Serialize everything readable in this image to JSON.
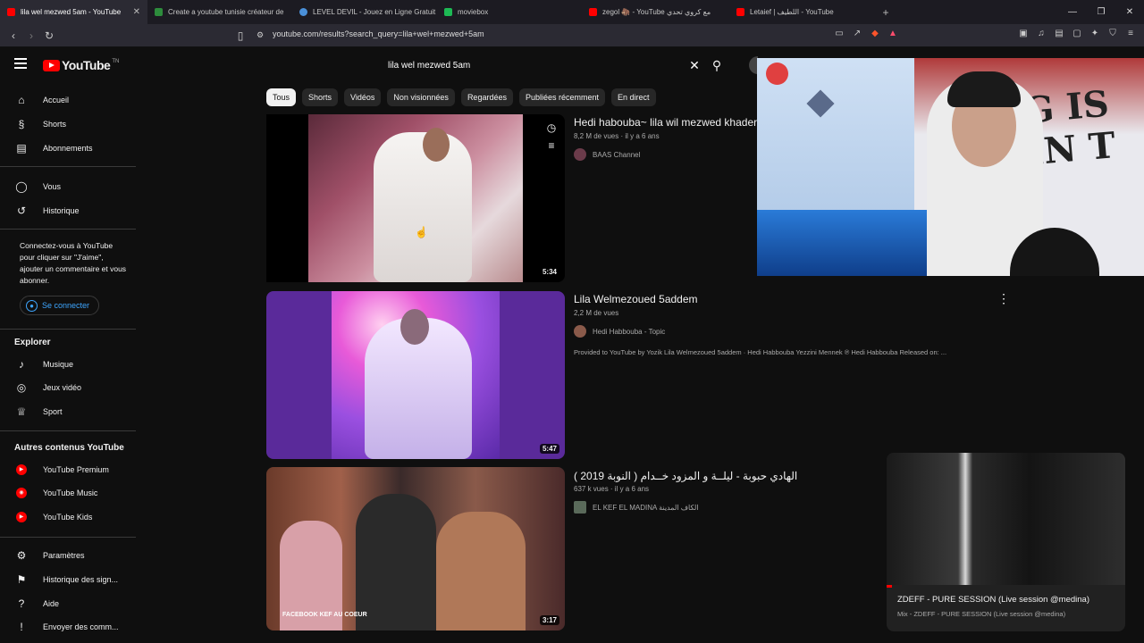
{
  "browser": {
    "tabs": [
      {
        "title": "lila wel mezwed 5am - YouTube",
        "color": "#ff0000",
        "active": true
      },
      {
        "title": "Create a youtube tunisie créateur de",
        "color": "#2d8c3c",
        "active": false
      },
      {
        "title": "LEVEL DEVIL - Jouez en Ligne Gratuit",
        "color": "#4a90d9",
        "active": false
      },
      {
        "title": "moviebox",
        "color": "#1db954",
        "active": false
      },
      {
        "title": "zegol 🦣 ‑ YouTube مع كروي تحدي",
        "color": "#ff0000",
        "active": false
      },
      {
        "title": "Letaief | اللطيف - YouTube",
        "color": "#ff0000",
        "active": false
      }
    ],
    "url": "youtube.com/results?search_query=lila+wel+mezwed+5am"
  },
  "header": {
    "logo": "YouTube",
    "logo_suffix": "TN",
    "search_query": "lila wel mezwed 5am"
  },
  "chips": [
    "Tous",
    "Shorts",
    "Vidéos",
    "Non visionnées",
    "Regardées",
    "Publiées récemment",
    "En direct"
  ],
  "sidebar": {
    "top": [
      {
        "label": "Accueil",
        "icon": "home-icon"
      },
      {
        "label": "Shorts",
        "icon": "shorts-icon"
      },
      {
        "label": "Abonnements",
        "icon": "subscriptions-icon"
      }
    ],
    "you": [
      {
        "label": "Vous",
        "icon": "user-icon"
      },
      {
        "label": "Historique",
        "icon": "history-icon"
      }
    ],
    "signin_text": "Connectez-vous à YouTube pour cliquer sur \"J'aime\", ajouter un commentaire et vous abonner.",
    "signin_button": "Se connecter",
    "explore_heading": "Explorer",
    "explore": [
      {
        "label": "Musique",
        "icon": "music-icon"
      },
      {
        "label": "Jeux vidéo",
        "icon": "gaming-icon"
      },
      {
        "label": "Sport",
        "icon": "trophy-icon"
      }
    ],
    "more_heading": "Autres contenus YouTube",
    "more": [
      {
        "label": "YouTube Premium"
      },
      {
        "label": "YouTube Music"
      },
      {
        "label": "YouTube Kids"
      }
    ],
    "bottom": [
      {
        "label": "Paramètres",
        "icon": "gear-icon"
      },
      {
        "label": "Historique des sign...",
        "icon": "flag-icon"
      },
      {
        "label": "Aide",
        "icon": "help-icon"
      },
      {
        "label": "Envoyer des comm...",
        "icon": "feedback-icon"
      }
    ]
  },
  "results": [
    {
      "title": "Hedi habouba~ lila wil mezwed khader",
      "meta": "8,2 M de vues · il y a 6 ans",
      "channel": "BAAS Channel",
      "duration": "5:34",
      "description": ""
    },
    {
      "title": "Lila Welmezoued 5addem",
      "meta": "2,2 M de vues",
      "channel": "Hedi Habbouba - Topic",
      "duration": "5:47",
      "description": "Provided to YouTube by Yozik Lila Welmezoued 5addem · Hedi Habbouba Yezzini Mennek ℗ Hedi Habbouba Released on: ..."
    },
    {
      "title": "الهادي حبوبة - ليلــة و المزود خــدام ( النوبة 2019 )",
      "meta": "637 k vues · il y a 6 ans",
      "channel": "EL KEF EL MADINA الكاف المدينة",
      "duration": "3:17",
      "description": "",
      "thumb_text": "FACEBOOK KEF AU COEUR"
    }
  ],
  "miniplayer": {
    "title": "ZDEFF - PURE SESSION (Live session @medina)",
    "subtitle": "Mix - ZDEFF - PURE SESSION (Live session @medina)"
  }
}
